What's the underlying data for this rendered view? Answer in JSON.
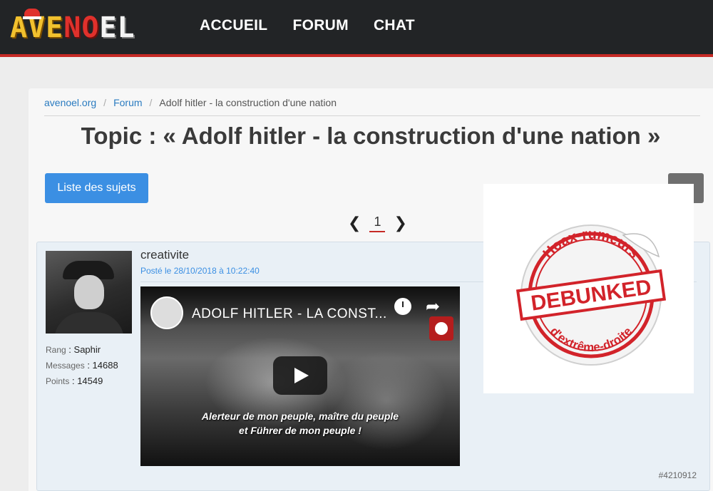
{
  "header": {
    "logo": {
      "part1": "AVE",
      "part2": "NO",
      "part3": "EL"
    },
    "nav": [
      "ACCUEIL",
      "FORUM",
      "CHAT"
    ]
  },
  "breadcrumb": {
    "home": "avenoel.org",
    "sep": "/",
    "forum": "Forum",
    "current": "Adolf hitler - la construction d'une nation"
  },
  "page_title": "Topic : « Adolf hitler - la construction d'une nation »",
  "list_button": "Liste des sujets",
  "pagination": {
    "prev": "❮",
    "current": "1",
    "next": "❯"
  },
  "post": {
    "author": "creativite",
    "posted": "Posté le 28/10/2018 à 10:22:40",
    "rank_label": "Rang",
    "rank": "Saphir",
    "messages_label": "Messages",
    "messages": "14688",
    "points_label": "Points",
    "points": "14549",
    "id": "#4210912",
    "video": {
      "title": "ADOLF HITLER - LA CONST...",
      "subtitle_line1": "Alerteur de mon peuple, maître du peuple",
      "subtitle_line2": "et Führer de mon peuple !"
    }
  },
  "overlay": {
    "top_text": "Hoax-rumeurs",
    "stamp": "DEBUNKED",
    "bottom_text": "d'extrême-droite"
  },
  "colors": {
    "accent": "#3b8fe3",
    "brand_red": "#c62a25",
    "header_bg": "#222426",
    "stamp_red": "#d2232a"
  }
}
